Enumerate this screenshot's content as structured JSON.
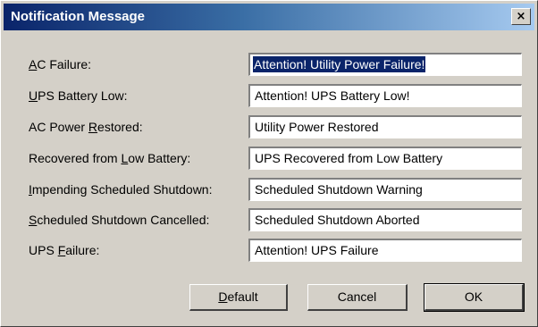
{
  "window": {
    "title": "Notification Message",
    "close_symbol": "×"
  },
  "fields": [
    {
      "label_pre": "",
      "label_key": "A",
      "label_post": "C Failure:",
      "value": "Attention! Utility Power Failure!",
      "selected": true
    },
    {
      "label_pre": "",
      "label_key": "U",
      "label_post": "PS Battery Low:",
      "value": "Attention! UPS Battery Low!",
      "selected": false
    },
    {
      "label_pre": "AC Power ",
      "label_key": "R",
      "label_post": "estored:",
      "value": "Utility Power Restored",
      "selected": false
    },
    {
      "label_pre": "Recovered from ",
      "label_key": "L",
      "label_post": "ow Battery:",
      "value": "UPS Recovered from Low Battery",
      "selected": false
    },
    {
      "label_pre": "",
      "label_key": "I",
      "label_post": "mpending Scheduled Shutdown:",
      "value": "Scheduled Shutdown Warning",
      "selected": false
    },
    {
      "label_pre": "",
      "label_key": "S",
      "label_post": "cheduled Shutdown Cancelled:",
      "value": "Scheduled Shutdown Aborted",
      "selected": false
    },
    {
      "label_pre": "UPS ",
      "label_key": "F",
      "label_post": "ailure:",
      "value": "Attention! UPS Failure",
      "selected": false
    }
  ],
  "buttons": {
    "default_key": "D",
    "default_rest": "efault",
    "cancel": "Cancel",
    "ok": "OK"
  },
  "colors": {
    "face": "#d4d0c8",
    "title_gradient_start": "#0a246a",
    "title_gradient_end": "#a6caf0",
    "selection": "#0a246a"
  }
}
